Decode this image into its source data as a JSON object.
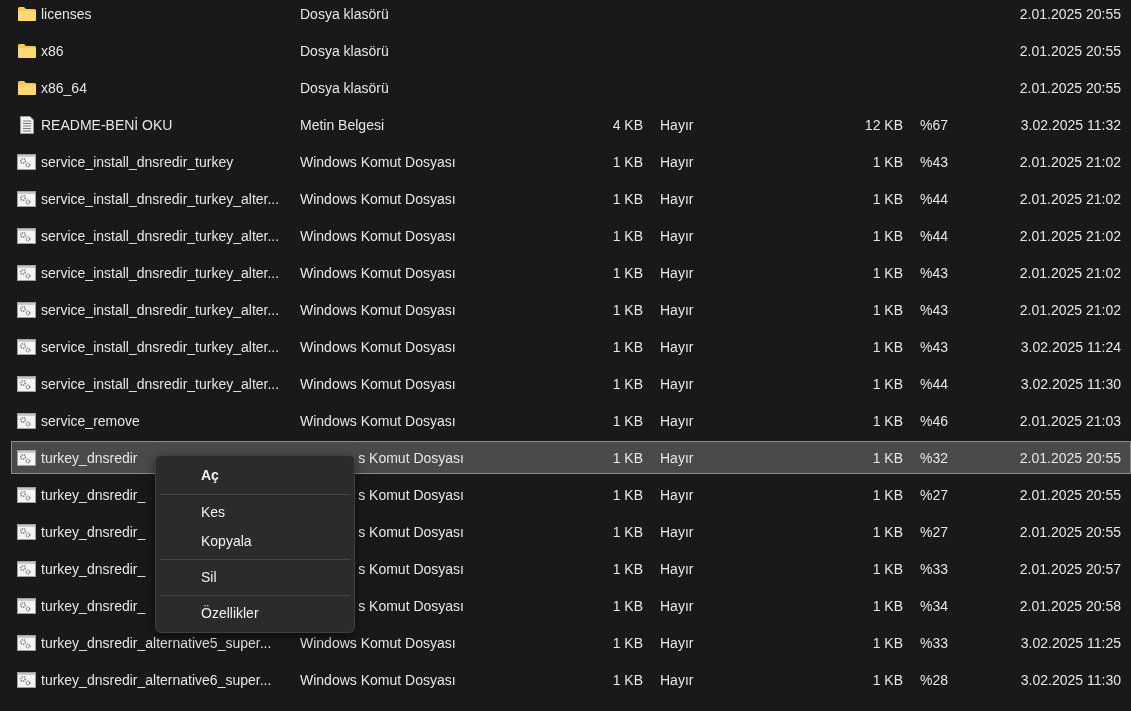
{
  "files": [
    {
      "kind": "folder",
      "name": "licenses",
      "type": "Dosya klasörü",
      "modified": "2.01.2025 20:55",
      "selected": false
    },
    {
      "kind": "folder",
      "name": "x86",
      "type": "Dosya klasörü",
      "modified": "2.01.2025 20:55",
      "selected": false
    },
    {
      "kind": "folder",
      "name": "x86_64",
      "type": "Dosya klasörü",
      "modified": "2.01.2025 20:55",
      "selected": false
    },
    {
      "kind": "text",
      "name": "README-BENİ OKU",
      "type": "Metin Belgesi",
      "size": "4 KB",
      "compressed": "Hayır",
      "compressed_size": "12 KB",
      "ratio": "%67",
      "modified": "3.02.2025 11:32",
      "selected": false
    },
    {
      "kind": "script",
      "name": "service_install_dnsredir_turkey",
      "type": "Windows Komut Dosyası",
      "size": "1 KB",
      "compressed": "Hayır",
      "compressed_size": "1 KB",
      "ratio": "%43",
      "modified": "2.01.2025 21:02",
      "selected": false
    },
    {
      "kind": "script",
      "name": "service_install_dnsredir_turkey_alter...",
      "type": "Windows Komut Dosyası",
      "size": "1 KB",
      "compressed": "Hayır",
      "compressed_size": "1 KB",
      "ratio": "%44",
      "modified": "2.01.2025 21:02",
      "selected": false
    },
    {
      "kind": "script",
      "name": "service_install_dnsredir_turkey_alter...",
      "type": "Windows Komut Dosyası",
      "size": "1 KB",
      "compressed": "Hayır",
      "compressed_size": "1 KB",
      "ratio": "%44",
      "modified": "2.01.2025 21:02",
      "selected": false
    },
    {
      "kind": "script",
      "name": "service_install_dnsredir_turkey_alter...",
      "type": "Windows Komut Dosyası",
      "size": "1 KB",
      "compressed": "Hayır",
      "compressed_size": "1 KB",
      "ratio": "%43",
      "modified": "2.01.2025 21:02",
      "selected": false
    },
    {
      "kind": "script",
      "name": "service_install_dnsredir_turkey_alter...",
      "type": "Windows Komut Dosyası",
      "size": "1 KB",
      "compressed": "Hayır",
      "compressed_size": "1 KB",
      "ratio": "%43",
      "modified": "2.01.2025 21:02",
      "selected": false
    },
    {
      "kind": "script",
      "name": "service_install_dnsredir_turkey_alter...",
      "type": "Windows Komut Dosyası",
      "size": "1 KB",
      "compressed": "Hayır",
      "compressed_size": "1 KB",
      "ratio": "%43",
      "modified": "3.02.2025 11:24",
      "selected": false
    },
    {
      "kind": "script",
      "name": "service_install_dnsredir_turkey_alter...",
      "type": "Windows Komut Dosyası",
      "size": "1 KB",
      "compressed": "Hayır",
      "compressed_size": "1 KB",
      "ratio": "%44",
      "modified": "3.02.2025 11:30",
      "selected": false
    },
    {
      "kind": "script",
      "name": "service_remove",
      "type": "Windows Komut Dosyası",
      "size": "1 KB",
      "compressed": "Hayır",
      "compressed_size": "1 KB",
      "ratio": "%46",
      "modified": "2.01.2025 21:03",
      "selected": false
    },
    {
      "kind": "script",
      "name": "turkey_dnsredir",
      "type": "s Komut Dosyası",
      "type_covered": true,
      "size": "1 KB",
      "compressed": "Hayır",
      "compressed_size": "1 KB",
      "ratio": "%32",
      "modified": "2.01.2025 20:55",
      "selected": true
    },
    {
      "kind": "script",
      "name": "turkey_dnsredir_",
      "type": "s Komut Dosyası",
      "type_covered": true,
      "size": "1 KB",
      "compressed": "Hayır",
      "compressed_size": "1 KB",
      "ratio": "%27",
      "modified": "2.01.2025 20:55",
      "selected": false
    },
    {
      "kind": "script",
      "name": "turkey_dnsredir_",
      "type": "s Komut Dosyası",
      "type_covered": true,
      "size": "1 KB",
      "compressed": "Hayır",
      "compressed_size": "1 KB",
      "ratio": "%27",
      "modified": "2.01.2025 20:55",
      "selected": false
    },
    {
      "kind": "script",
      "name": "turkey_dnsredir_",
      "type": "s Komut Dosyası",
      "type_covered": true,
      "size": "1 KB",
      "compressed": "Hayır",
      "compressed_size": "1 KB",
      "ratio": "%33",
      "modified": "2.01.2025 20:57",
      "selected": false
    },
    {
      "kind": "script",
      "name": "turkey_dnsredir_",
      "type": "s Komut Dosyası",
      "type_covered": true,
      "size": "1 KB",
      "compressed": "Hayır",
      "compressed_size": "1 KB",
      "ratio": "%34",
      "modified": "2.01.2025 20:58",
      "selected": false
    },
    {
      "kind": "script",
      "name": "turkey_dnsredir_alternative5_super...",
      "type": "Windows Komut Dosyası",
      "size": "1 KB",
      "compressed": "Hayır",
      "compressed_size": "1 KB",
      "ratio": "%33",
      "modified": "3.02.2025 11:25",
      "selected": false
    },
    {
      "kind": "script",
      "name": "turkey_dnsredir_alternative6_super...",
      "type": "Windows Komut Dosyası",
      "size": "1 KB",
      "compressed": "Hayır",
      "compressed_size": "1 KB",
      "ratio": "%28",
      "modified": "3.02.2025 11:30",
      "selected": false
    }
  ],
  "context_menu": [
    {
      "kind": "item",
      "label": "Aç",
      "default": true
    },
    {
      "kind": "separator"
    },
    {
      "kind": "item",
      "label": "Kes",
      "default": false
    },
    {
      "kind": "item",
      "label": "Kopyala",
      "default": false
    },
    {
      "kind": "separator"
    },
    {
      "kind": "item",
      "label": "Sil",
      "default": false
    },
    {
      "kind": "separator"
    },
    {
      "kind": "item",
      "label": "Özellikler",
      "default": false
    }
  ]
}
